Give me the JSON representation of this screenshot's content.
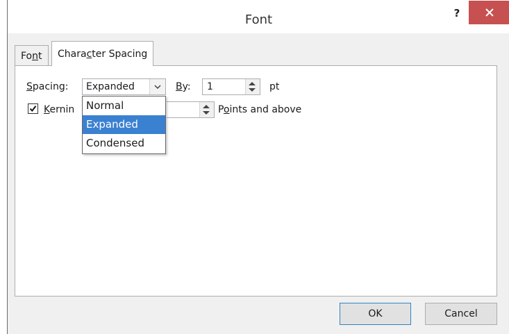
{
  "window": {
    "title": "Font",
    "help_label": "?"
  },
  "tabs": [
    {
      "label_pre": "Fo",
      "label_key": "n",
      "label_post": "t",
      "selected": false
    },
    {
      "label_pre": "Chara",
      "label_key": "c",
      "label_post": "ter Spacing",
      "selected": true
    }
  ],
  "spacing": {
    "label_key": "S",
    "label_rest": "pacing:",
    "value": "Expanded",
    "options": [
      "Normal",
      "Expanded",
      "Condensed"
    ],
    "selected_option": "Expanded"
  },
  "by": {
    "label_key": "B",
    "label_rest": "y:",
    "value": "1",
    "unit": "pt"
  },
  "kerning": {
    "label_key": "K",
    "label_rest": "ernin",
    "checked": true,
    "value": "",
    "suffix_key": "o",
    "suffix_pre": "P",
    "suffix_rest": "ints and above"
  },
  "buttons": {
    "ok": "OK",
    "cancel": "Cancel"
  },
  "colors": {
    "close_button": "#c75050",
    "selection": "#3b81d1",
    "dialog_bg": "#f0f0f0"
  },
  "icons": [
    "close-icon",
    "chevron-down-icon",
    "spin-up-icon",
    "spin-down-icon",
    "checkmark-icon"
  ]
}
